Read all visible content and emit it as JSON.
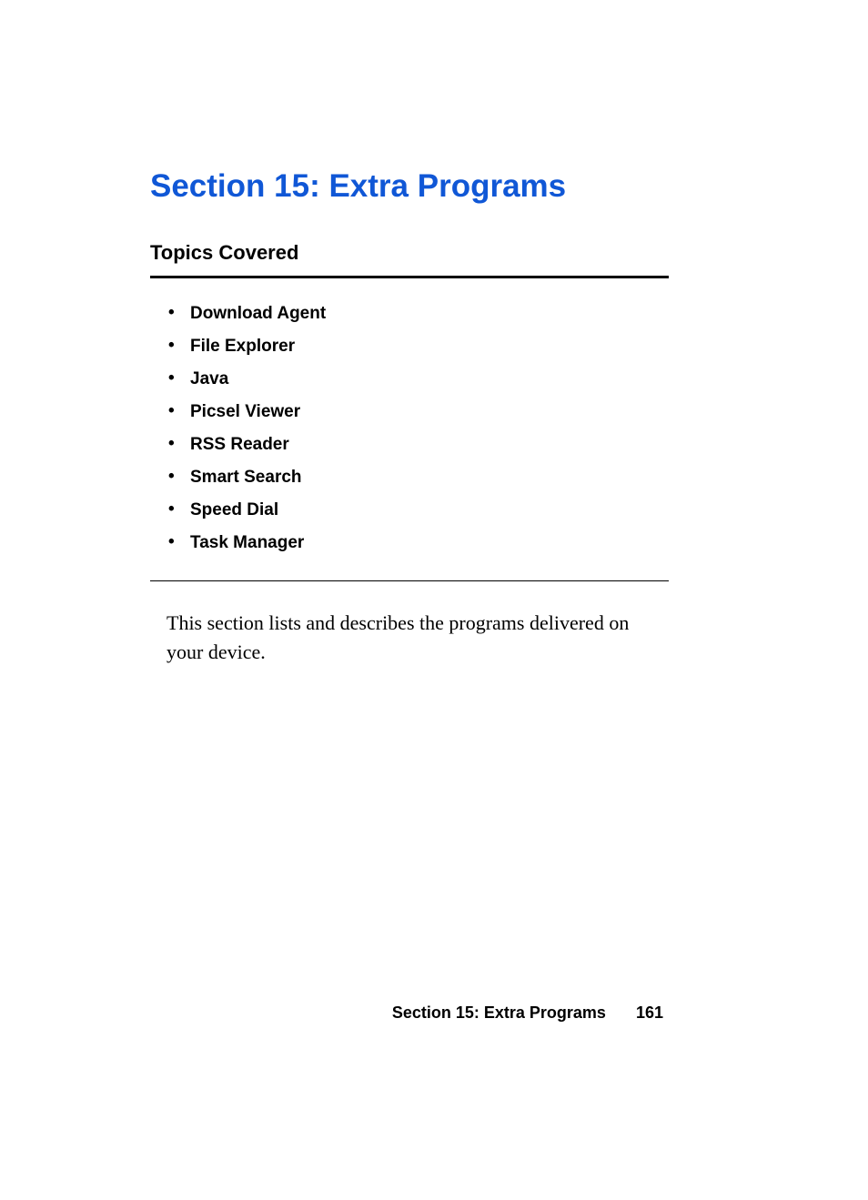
{
  "title": "Section 15: Extra Programs",
  "subheading": "Topics Covered",
  "topics": [
    "Download Agent",
    "File Explorer",
    "Java",
    "Picsel Viewer",
    "RSS Reader",
    "Smart Search",
    "Speed Dial",
    "Task Manager"
  ],
  "body": "This section lists and describes the programs delivered on your device.",
  "footer": {
    "section_label": "Section 15: Extra Programs",
    "page_number": "161"
  }
}
